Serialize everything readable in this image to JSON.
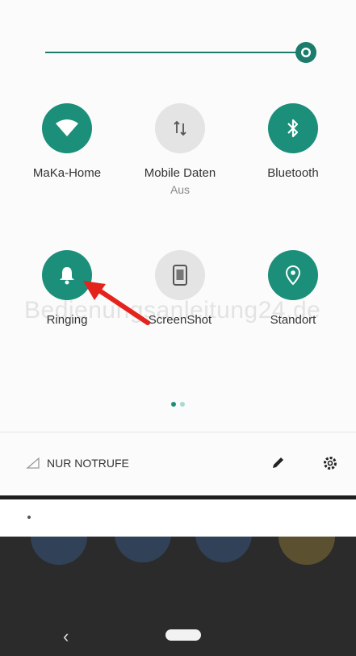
{
  "brightness": {
    "level": 0.96,
    "accent": "#1c7c6b"
  },
  "tiles": [
    {
      "label": "MaKa-Home",
      "sub": "",
      "icon": "wifi-icon",
      "active": true
    },
    {
      "label": "Mobile Daten",
      "sub": "Aus",
      "icon": "mobile-data-icon",
      "active": false
    },
    {
      "label": "Bluetooth",
      "sub": "",
      "icon": "bluetooth-icon",
      "active": true
    },
    {
      "label": "Ringing",
      "sub": "",
      "icon": "bell-icon",
      "active": true
    },
    {
      "label": "ScreenShot",
      "sub": "",
      "icon": "screenshot-icon",
      "active": false
    },
    {
      "label": "Standort",
      "sub": "",
      "icon": "location-icon",
      "active": true
    }
  ],
  "page_indicator": {
    "pages": 2,
    "current": 1
  },
  "footer": {
    "mode_text": "NUR NOTRUFE"
  },
  "watermark": "Bedienungsanleitung24.de",
  "colors": {
    "active_tile": "#1b8f7a",
    "inactive_tile": "#e4e4e4",
    "arrow": "#e3231c"
  }
}
